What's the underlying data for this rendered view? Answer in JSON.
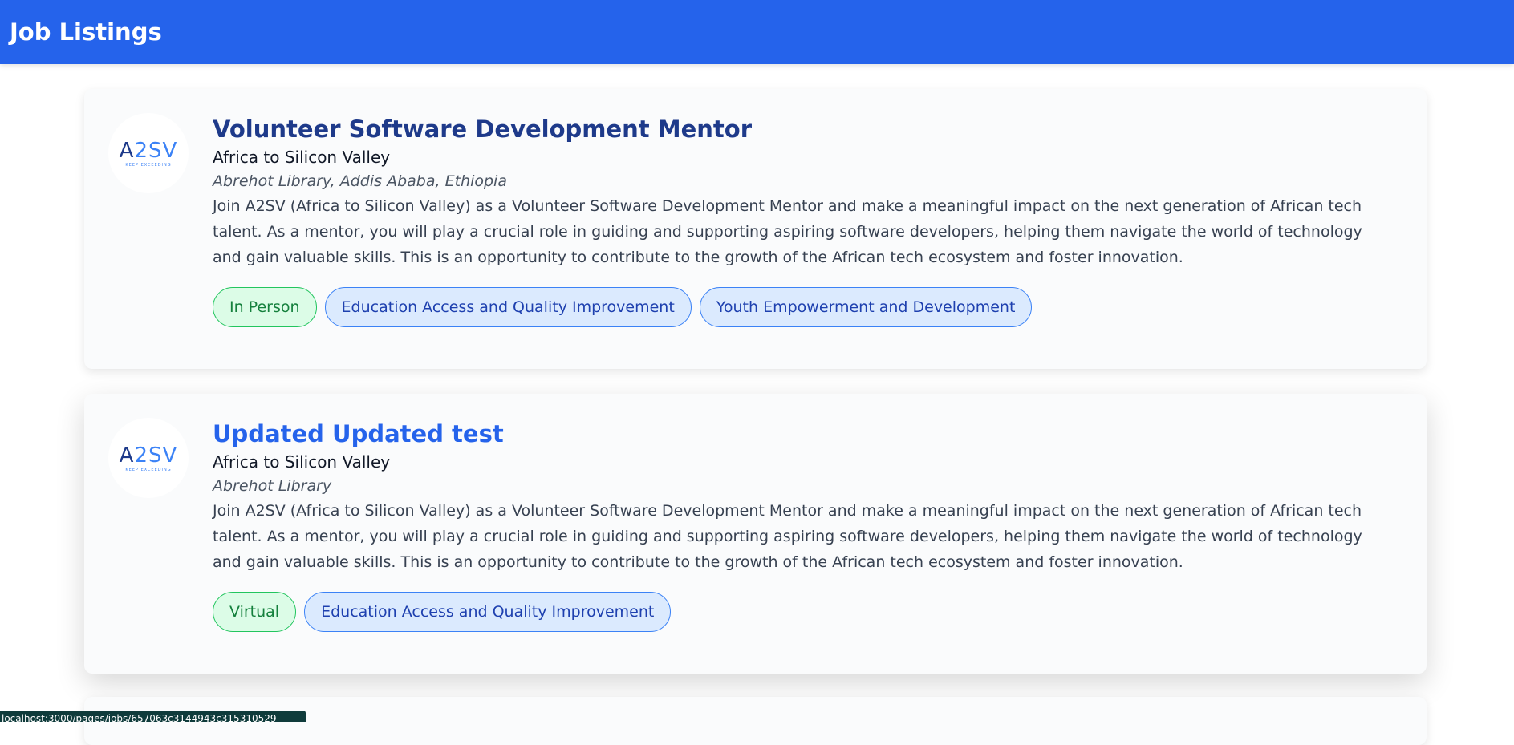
{
  "header": {
    "title": "Job Listings"
  },
  "jobs": [
    {
      "title": "Volunteer Software Development Mentor",
      "company": "Africa to Silicon Valley",
      "location": "Abrehot Library, Addis Ababa, Ethiopia",
      "description": "Join A2SV (Africa to Silicon Valley) as a Volunteer Software Development Mentor and make a meaningful impact on the next generation of African tech talent. As a mentor, you will play a crucial role in guiding and supporting aspiring software developers, helping them navigate the world of technology and gain valuable skills. This is an opportunity to contribute to the growth of the African tech ecosystem and foster innovation.",
      "logo": {
        "text_a": "A",
        "text_b": "2SV",
        "tagline": "KEEP EXCEEDING"
      },
      "tags": [
        {
          "label": "In Person",
          "color": "green"
        },
        {
          "label": "Education Access and Quality Improvement",
          "color": "blue"
        },
        {
          "label": "Youth Empowerment and Development",
          "color": "blue"
        }
      ]
    },
    {
      "title": "Updated Updated test",
      "company": "Africa to Silicon Valley",
      "location": "Abrehot Library",
      "description": "Join A2SV (Africa to Silicon Valley) as a Volunteer Software Development Mentor and make a meaningful impact on the next generation of African tech talent. As a mentor, you will play a crucial role in guiding and supporting aspiring software developers, helping them navigate the world of technology and gain valuable skills. This is an opportunity to contribute to the growth of the African tech ecosystem and foster innovation.",
      "logo": {
        "text_a": "A",
        "text_b": "2SV",
        "tagline": "KEEP EXCEEDING"
      },
      "tags": [
        {
          "label": "Virtual",
          "color": "green"
        },
        {
          "label": "Education Access and Quality Improvement",
          "color": "blue"
        }
      ]
    }
  ],
  "status_bar": {
    "url": "localhost:3000/pages/jobs/657063c3144943c315310529"
  },
  "colors": {
    "header_bg": "#2563eb",
    "title_dark": "#1e3a8a",
    "title_link": "#2563eb",
    "tag_green_bg": "#dcfce7",
    "tag_blue_bg": "#dbeafe"
  }
}
